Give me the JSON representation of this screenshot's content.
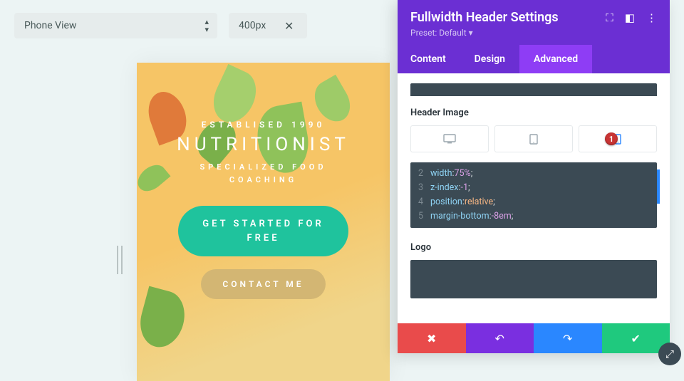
{
  "topbar": {
    "view_select": "Phone View",
    "width_value": "400px"
  },
  "hero": {
    "established": "ESTABLISED 1990",
    "brand": "NUTRITIONIST",
    "sub1": "SPECIALIZED FOOD",
    "sub2": "COACHING",
    "cta_primary_l1": "GET STARTED FOR",
    "cta_primary_l2": "FREE",
    "cta_secondary": "CONTACT ME"
  },
  "panel": {
    "title": "Fullwidth Header Settings",
    "preset_label": "Preset: Default ▾",
    "tabs": {
      "content": "Content",
      "design": "Design",
      "advanced": "Advanced"
    },
    "section_header_image": "Header Image",
    "badge_num": "1",
    "code": {
      "lines": [
        {
          "n": "2",
          "prop": "width",
          "val": "75%",
          "valClass": "val-pct"
        },
        {
          "n": "3",
          "prop": "z-index",
          "val": "-1",
          "valClass": "val-num"
        },
        {
          "n": "4",
          "prop": "position",
          "val": "relative",
          "valClass": "val-kw"
        },
        {
          "n": "5",
          "prop": "margin-bottom",
          "val": "-8em",
          "valClass": "val-num"
        }
      ]
    },
    "section_logo": "Logo"
  }
}
